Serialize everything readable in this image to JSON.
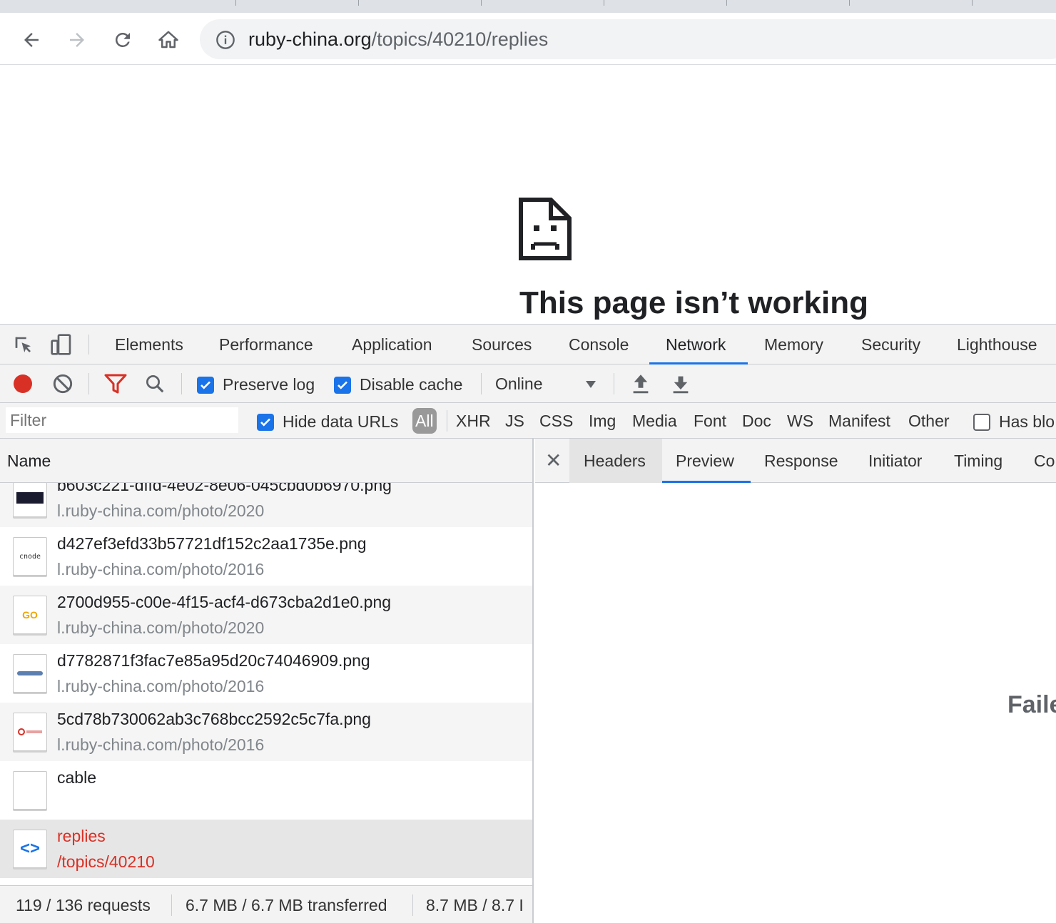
{
  "browser": {
    "url_host": "ruby-china.org",
    "url_path": "/topics/40210/replies"
  },
  "page": {
    "error_title": "This page isn’t working"
  },
  "devtools": {
    "tabs": [
      "Elements",
      "Performance",
      "Application",
      "Sources",
      "Console",
      "Network",
      "Memory",
      "Security",
      "Lighthouse"
    ],
    "active_tab": "Network",
    "toolbar": {
      "preserve_log": "Preserve log",
      "disable_cache": "Disable cache",
      "throttling": "Online"
    },
    "filter": {
      "placeholder": "Filter",
      "hide_data_urls": "Hide data URLs",
      "types": [
        "All",
        "XHR",
        "JS",
        "CSS",
        "Img",
        "Media",
        "Font",
        "Doc",
        "WS",
        "Manifest",
        "Other"
      ],
      "has_blocked": "Has blo"
    },
    "list": {
      "column_name": "Name",
      "rows": [
        {
          "name": "b603c221-dffd-4e02-8e06-045cbd0b6970.png",
          "path": "l.ruby-china.com/photo/2020",
          "thumb": ""
        },
        {
          "name": "d427ef3efd33b57721df152c2aa1735e.png",
          "path": "l.ruby-china.com/photo/2016",
          "thumb": "cnode"
        },
        {
          "name": "2700d955-c00e-4f15-acf4-d673cba2d1e0.png",
          "path": "l.ruby-china.com/photo/2020",
          "thumb": "GO"
        },
        {
          "name": "d7782871f3fac7e85a95d20c74046909.png",
          "path": "l.ruby-china.com/photo/2016",
          "thumb": ""
        },
        {
          "name": "5cd78b730062ab3c768bcc2592c5c7fa.png",
          "path": "l.ruby-china.com/photo/2016",
          "thumb": ""
        },
        {
          "name": "cable",
          "path": "",
          "thumb": ""
        },
        {
          "name": "replies",
          "path": "/topics/40210",
          "thumb": "<>"
        }
      ],
      "status": {
        "requests": "119 / 136 requests",
        "transferred": "6.7 MB / 6.7 MB transferred",
        "resources": "8.7 MB / 8.7 I"
      }
    },
    "detail": {
      "tabs": [
        "Headers",
        "Preview",
        "Response",
        "Initiator",
        "Timing",
        "Co"
      ],
      "active_tab": "Preview",
      "failed_text": "Faile"
    }
  },
  "colors": {
    "accent": "#1a73e8",
    "record": "#d93025",
    "error_text": "#d93025"
  }
}
